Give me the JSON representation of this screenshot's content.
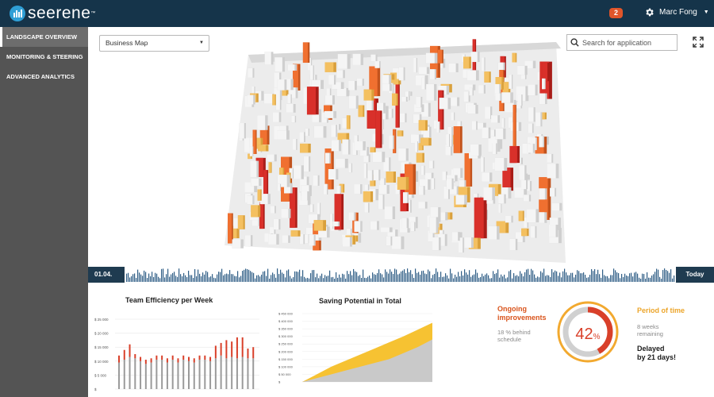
{
  "app": {
    "brand": "seerene",
    "trademark": "™",
    "notifications": "2",
    "user_name": "Marc Fong",
    "gear_icon": "gear-icon",
    "colors": {
      "header": "#15344a",
      "accent_red": "#d9402a",
      "accent_orange": "#eca52a"
    }
  },
  "sidebar": {
    "items": [
      {
        "label": "LANDSCAPE OVERVIEW",
        "active": true
      },
      {
        "label": "MONITORING & STEERING",
        "active": false
      },
      {
        "label": "ADVANCED ANALYTICS",
        "active": false
      }
    ]
  },
  "toolbar": {
    "map_select": "Business Map",
    "search_placeholder": "Search for application",
    "search_icon": "search-icon",
    "fullscreen_icon": "fullscreen-icon"
  },
  "timeline": {
    "start": "01.04.",
    "end": "Today"
  },
  "charts": {
    "efficiency_title": "Team Efficiency per Week",
    "saving_title": "Saving Potential in Total"
  },
  "chart_data": [
    {
      "type": "bar",
      "title": "Team Efficiency per Week",
      "ylim": [
        0,
        25000
      ],
      "y_ticks": [
        "$ 25 000",
        "$ 20 000",
        "$ 15 000",
        "$ 10 000",
        "$  5 000",
        "$"
      ],
      "series": [
        {
          "values": [
            9500,
            10500,
            11500,
            11000,
            10000,
            9000,
            9500,
            10500,
            10500,
            9500,
            10500,
            9500,
            10500,
            10000,
            9500,
            10500,
            10500,
            10000,
            11000,
            12000,
            11000,
            11500,
            11000,
            11500,
            11000,
            11000
          ]
        },
        {
          "values": [
            2500,
            3500,
            4500,
            1500,
            1500,
            1500,
            1500,
            1500,
            1500,
            1500,
            1500,
            1500,
            1500,
            1500,
            1500,
            1500,
            1500,
            1500,
            4500,
            4500,
            6500,
            5500,
            7500,
            7000,
            3500,
            4000
          ]
        }
      ]
    },
    {
      "type": "area",
      "title": "Saving Potential in Total",
      "ylim": [
        0,
        450000
      ],
      "y_ticks": [
        "$ 450 000",
        "$ 400 000",
        "$ 350 000",
        "$ 300 000",
        "$ 250 000",
        "$ 200 000",
        "$ 150 000",
        "$ 100 000",
        "$  50 000",
        "$"
      ],
      "series": [
        {
          "values": [
            0,
            25000,
            50000,
            75000,
            100000,
            125000,
            150000,
            190000,
            230000,
            280000
          ]
        },
        {
          "values": [
            0,
            50000,
            100000,
            140000,
            180000,
            220000,
            260000,
            300000,
            345000,
            390000
          ]
        }
      ]
    }
  ],
  "progress": {
    "value": 42,
    "value_text": "42",
    "unit": "%",
    "ongoing_label": "Ongoing\nimprovements",
    "ongoing_sub": "18 % behind\nschedule",
    "period_label": "Period of time",
    "period_sub": "8 weeks\nremaining",
    "delay_text": "Delayed\nby 21 days!"
  }
}
